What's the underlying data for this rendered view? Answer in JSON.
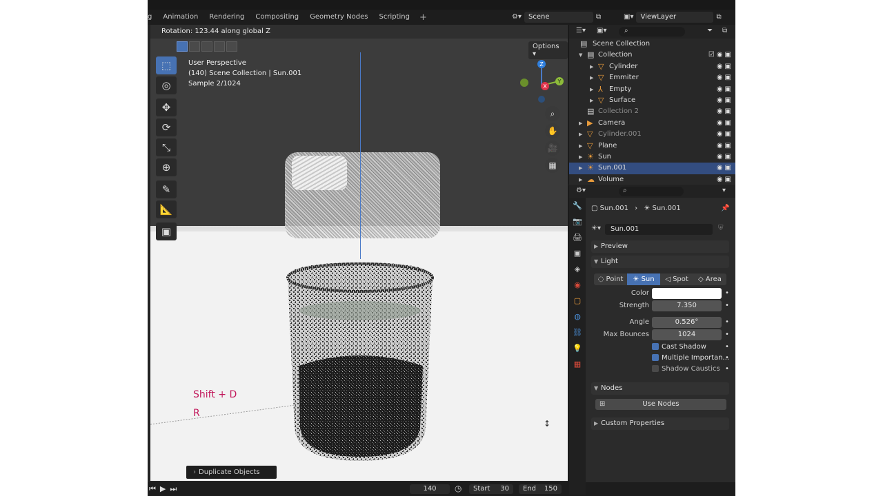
{
  "workspace_tabs": [
    "g",
    "Animation",
    "Rendering",
    "Compositing",
    "Geometry Nodes",
    "Scripting"
  ],
  "scene": {
    "label": "Scene"
  },
  "view_layer": {
    "label": "ViewLayer"
  },
  "viewport": {
    "header_message": "Rotation: 123.44 along global Z",
    "options_label": "Options",
    "overlay_lines": [
      "User Perspective",
      "(140) Scene Collection | Sun.001",
      "Sample 2/1024"
    ],
    "gizmo": {
      "z": "Z",
      "x": "X",
      "y": "Y"
    },
    "key_hints": [
      "Shift + D",
      "R"
    ],
    "last_operator": "Duplicate Objects"
  },
  "timeline": {
    "current_frame": "140",
    "start_label": "Start",
    "start_value": "30",
    "end_label": "End",
    "end_value": "150"
  },
  "outliner": {
    "root": "Scene Collection",
    "rows": [
      {
        "name": "Collection",
        "icon": "collection-icon",
        "dim": false,
        "selected": false
      },
      {
        "name": "Cylinder",
        "icon": "mesh-icon",
        "dim": false,
        "selected": false
      },
      {
        "name": "Emmiter",
        "icon": "mesh-icon",
        "dim": false,
        "selected": false
      },
      {
        "name": "Empty",
        "icon": "empty-icon",
        "dim": false,
        "selected": false
      },
      {
        "name": "Surface",
        "icon": "mesh-icon",
        "dim": false,
        "selected": false
      },
      {
        "name": "Collection 2",
        "icon": "collection-icon",
        "dim": true,
        "selected": false
      },
      {
        "name": "Camera",
        "icon": "camera-icon",
        "dim": false,
        "selected": false
      },
      {
        "name": "Cylinder.001",
        "icon": "mesh-icon",
        "dim": true,
        "selected": false
      },
      {
        "name": "Plane",
        "icon": "mesh-icon",
        "dim": false,
        "selected": false
      },
      {
        "name": "Sun",
        "icon": "light-icon",
        "dim": false,
        "selected": false
      },
      {
        "name": "Sun.001",
        "icon": "light-icon",
        "dim": false,
        "selected": true
      },
      {
        "name": "Volume",
        "icon": "volume-icon",
        "dim": false,
        "selected": false
      }
    ]
  },
  "properties": {
    "breadcrumb_object": "Sun.001",
    "breadcrumb_data": "Sun.001",
    "datablock_name": "Sun.001",
    "panels": {
      "preview": "Preview",
      "light": "Light",
      "nodes": "Nodes",
      "custom": "Custom Properties"
    },
    "light_types": [
      "Point",
      "Sun",
      "Spot",
      "Area"
    ],
    "active_light_type": "Sun",
    "color_label": "Color",
    "color_value": "#ffffff",
    "strength_label": "Strength",
    "strength_value": "7.350",
    "angle_label": "Angle",
    "angle_value": "0.526°",
    "max_bounces_label": "Max Bounces",
    "max_bounces_value": "1024",
    "cast_shadow": "Cast Shadow",
    "multiple_importance": "Multiple Importan...",
    "shadow_caustics": "Shadow Caustics",
    "use_nodes": "Use Nodes"
  },
  "colors": {
    "accent": "#4772b3",
    "selected_row": "#334d80",
    "mesh_icon": "#e89b3c",
    "data_icon": "#5fcf9a",
    "key_hint": "#c2185b"
  }
}
